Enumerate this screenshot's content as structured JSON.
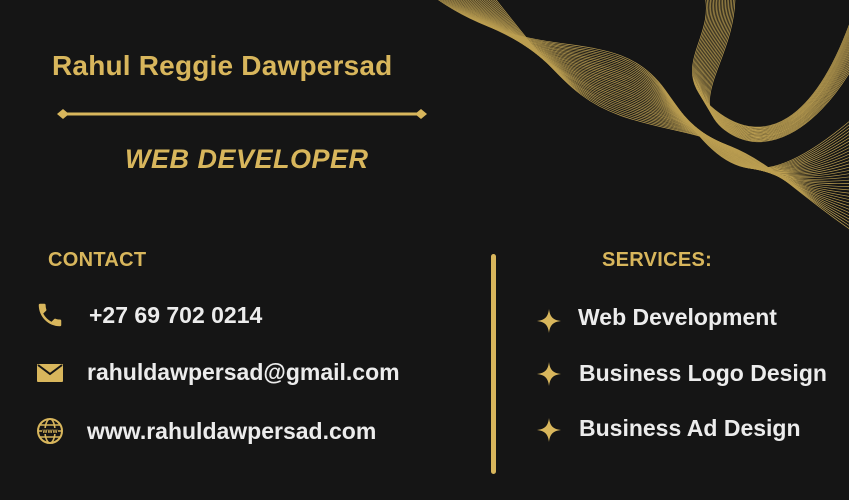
{
  "card": {
    "name": "Rahul Reggie Dawpersad",
    "title": "WEB DEVELOPER",
    "contact_heading": "CONTACT",
    "services_heading": "SERVICES:",
    "contacts": [
      {
        "icon": "phone-icon",
        "text": "+27 69 702 0214"
      },
      {
        "icon": "mail-icon",
        "text": "rahuldawpersad@gmail.com"
      },
      {
        "icon": "globe-icon",
        "text": "www.rahuldawpersad.com"
      }
    ],
    "services": [
      {
        "icon": "sparkle-icon",
        "text": "Web Development"
      },
      {
        "icon": "sparkle-icon",
        "text": "Business Logo Design"
      },
      {
        "icon": "sparkle-icon",
        "text": "Business Ad Design"
      }
    ],
    "colors": {
      "background": "#151515",
      "accent": "#d8b65c",
      "text": "#ececec"
    }
  }
}
